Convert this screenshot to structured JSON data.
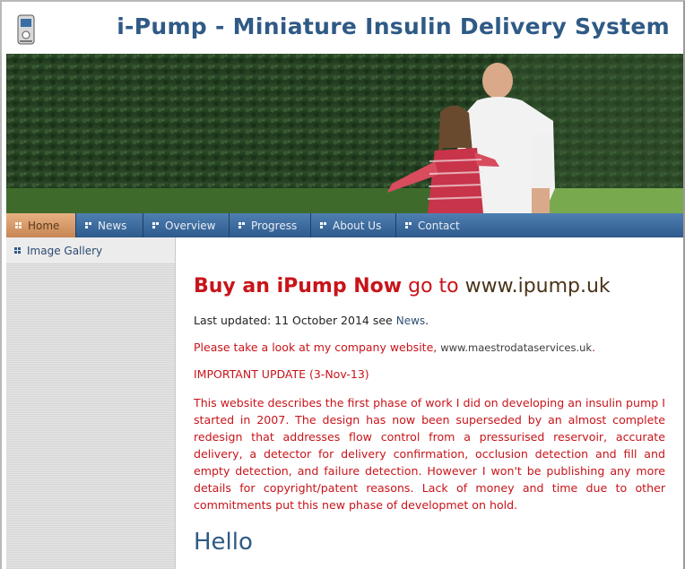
{
  "site": {
    "title": "i-Pump - Miniature Insulin Delivery System",
    "logo_icon": "pump-device-icon"
  },
  "nav": {
    "items": [
      {
        "label": "Home",
        "active": true
      },
      {
        "label": "News",
        "active": false
      },
      {
        "label": "Overview",
        "active": false
      },
      {
        "label": "Progress",
        "active": false
      },
      {
        "label": "About Us",
        "active": false
      },
      {
        "label": "Contact",
        "active": false
      }
    ]
  },
  "sidebar": {
    "items": [
      {
        "label": "Image Gallery"
      }
    ]
  },
  "content": {
    "buy_prefix": "Buy an iPump Now",
    "buy_middle": "go to",
    "buy_url": "www.ipump.uk",
    "updated_prefix": "Last updated: 11 October 2014 see",
    "updated_link": "News",
    "updated_suffix": ".",
    "company_prefix": "Please take a look at my company website,",
    "company_link": "www.maestrodataservices.uk",
    "company_suffix": ".",
    "important": "IMPORTANT UPDATE (3-Nov-13)",
    "description": "This website describes the first phase of work I did on developing an insulin pump I started in 2007. The design has now been superseded by an almost complete redesign that addresses flow control from a pressurised reservoir, accurate delivery, a detector for delivery confirmation, occlusion detection and fill and empty detection, and failure detection. However I won't be publishing any more details for copyright/patent reasons. Lack of money and time due to other commitments put this new phase of developmet on hold.",
    "hello": "Hello"
  },
  "colors": {
    "nav_bg": "#2e5a8c",
    "nav_active": "#c88554",
    "title": "#2f5a86",
    "accent_red": "#c8141a"
  }
}
